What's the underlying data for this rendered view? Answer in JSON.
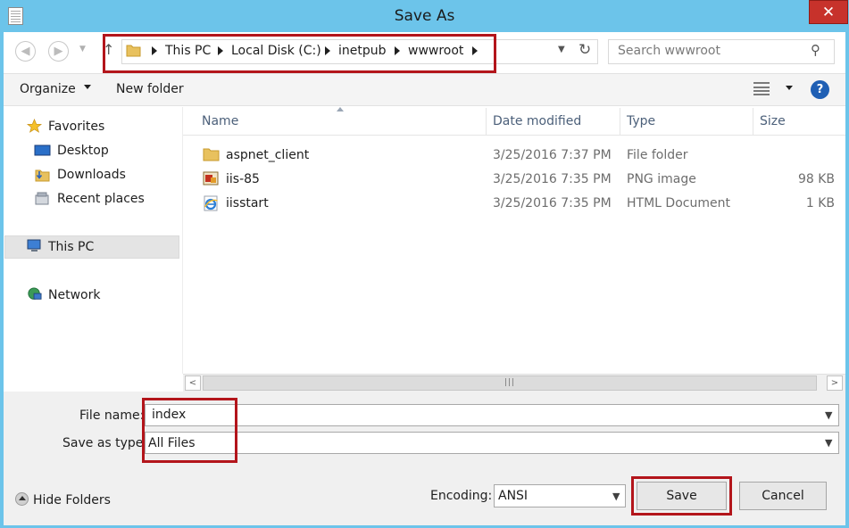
{
  "window": {
    "title": "Save As",
    "close_glyph": "✕"
  },
  "address": {
    "crumbs": [
      "This PC",
      "Local Disk (C:)",
      "inetpub",
      "wwwroot"
    ],
    "search_placeholder": "Search wwwroot"
  },
  "toolbar": {
    "organize": "Organize",
    "new_folder": "New folder",
    "help": "?"
  },
  "nav": {
    "favorites": "Favorites",
    "desktop": "Desktop",
    "downloads": "Downloads",
    "recent": "Recent places",
    "this_pc": "This PC",
    "network": "Network"
  },
  "columns": {
    "name": "Name",
    "date": "Date modified",
    "type": "Type",
    "size": "Size"
  },
  "files": [
    {
      "name": "aspnet_client",
      "date": "3/25/2016 7:37 PM",
      "type": "File folder",
      "size": ""
    },
    {
      "name": "iis-85",
      "date": "3/25/2016 7:35 PM",
      "type": "PNG image",
      "size": "98 KB"
    },
    {
      "name": "iisstart",
      "date": "3/25/2016 7:35 PM",
      "type": "HTML Document",
      "size": "1 KB"
    }
  ],
  "form": {
    "file_name_label": "File name:",
    "file_name_value": "index",
    "save_type_label": "Save as type:",
    "save_type_value": "All Files",
    "encoding_label": "Encoding:",
    "encoding_value": "ANSI"
  },
  "footer": {
    "hide_folders": "Hide Folders",
    "save": "Save",
    "cancel": "Cancel"
  },
  "colors": {
    "title_bg": "#6cc4ea",
    "close_bg": "#c7322b",
    "highlight": "#b3151b",
    "toolbar_bg": "#f4f4f4"
  }
}
